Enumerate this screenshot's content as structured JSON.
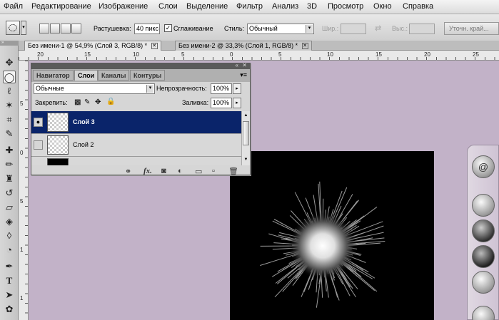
{
  "menu": [
    "Файл",
    "Редактирование",
    "Изображение",
    "Слои",
    "Выделение",
    "Фильтр",
    "Анализ",
    "3D",
    "Просмотр",
    "Окно",
    "Справка"
  ],
  "options": {
    "feather_label": "Растушевка:",
    "feather_value": "40 пикс",
    "antialias_label": "Сглаживание",
    "style_label": "Стиль:",
    "style_value": "Обычный",
    "width_label": "Шир.:",
    "height_label": "Выс.:",
    "refine_label": "Уточн. край..."
  },
  "tabs": [
    {
      "label": "Без имени-1 @ 54,9% (Слой 3, RGB/8) *"
    },
    {
      "label": "Без имени-2 @ 33,3% (Слой 1, RGB/8) *"
    }
  ],
  "ruler": {
    "h": [
      "20",
      "15",
      "10",
      "5",
      "0",
      "5",
      "10",
      "15",
      "20",
      "25"
    ],
    "v": [
      "5",
      "0",
      "5",
      "1",
      "1"
    ]
  },
  "layers_panel": {
    "tabs": [
      "Навигатор",
      "Слои",
      "Каналы",
      "Контуры"
    ],
    "blend_mode": "Обычные",
    "opacity_label": "Непрозрачность:",
    "opacity_value": "100%",
    "lock_label": "Закрепить:",
    "fill_label": "Заливка:",
    "fill_value": "100%",
    "layers": [
      {
        "name": "Слой 3",
        "selected": true,
        "visible": true
      },
      {
        "name": "Слой 2",
        "selected": false,
        "visible": false
      }
    ]
  },
  "colors": {
    "workspace": "#c2b2c8",
    "selected_layer": "#0a246a"
  }
}
